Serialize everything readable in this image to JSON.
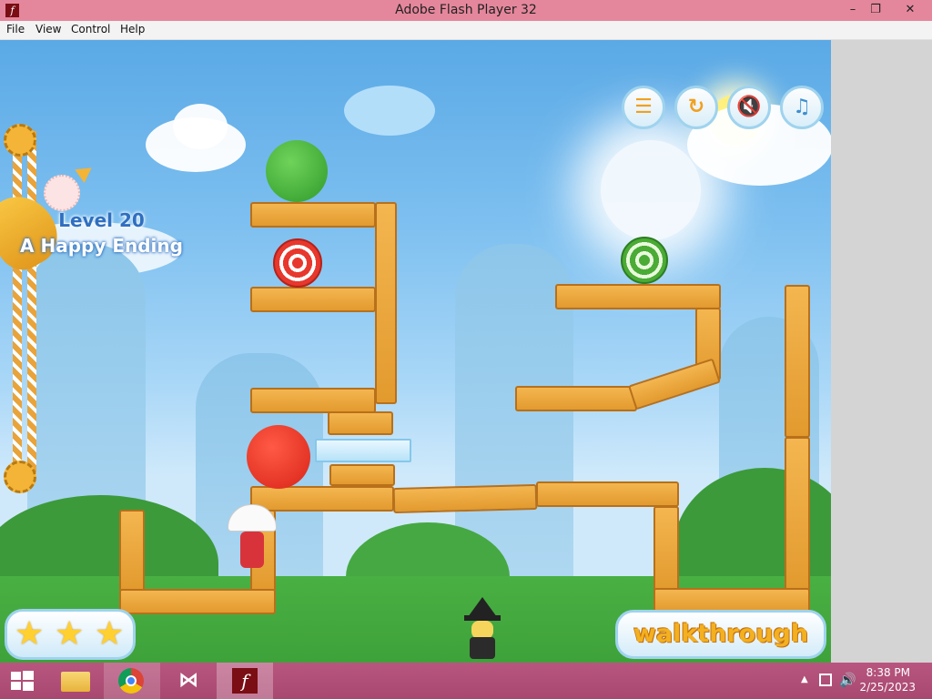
{
  "window": {
    "title": "Adobe Flash Player 32",
    "app_icon": "f"
  },
  "window_controls": {
    "minimize": "–",
    "restore": "❐",
    "close": "✕"
  },
  "menu": [
    "File",
    "View",
    "Control",
    "Help"
  ],
  "hud": {
    "menu_icon": "menu-icon",
    "restart_icon": "restart-icon",
    "sound_icon": "sound-muted-icon",
    "music_icon": "music-icon"
  },
  "level": {
    "number": "Level 20",
    "name": "A Happy Ending"
  },
  "stars": {
    "count": 3,
    "max": 3,
    "glyph": "★"
  },
  "walkthrough": {
    "label": "walkthrough"
  },
  "taskbar": {
    "items": [
      "windows-start-icon",
      "file-explorer-icon",
      "chrome-icon",
      "visual-studio-icon",
      "flash-player-icon"
    ],
    "clock": {
      "time": "8:38 PM",
      "date": "2/25/2023"
    },
    "tray": {
      "chevron": "▲",
      "network_icon": "network-icon",
      "volume_icon": "volume-icon"
    }
  },
  "colors": {
    "titlebar": "#e5879c",
    "taskbar": "#a84870",
    "accent_gold": "#f3b020",
    "level_blue": "#2f6fc0"
  }
}
